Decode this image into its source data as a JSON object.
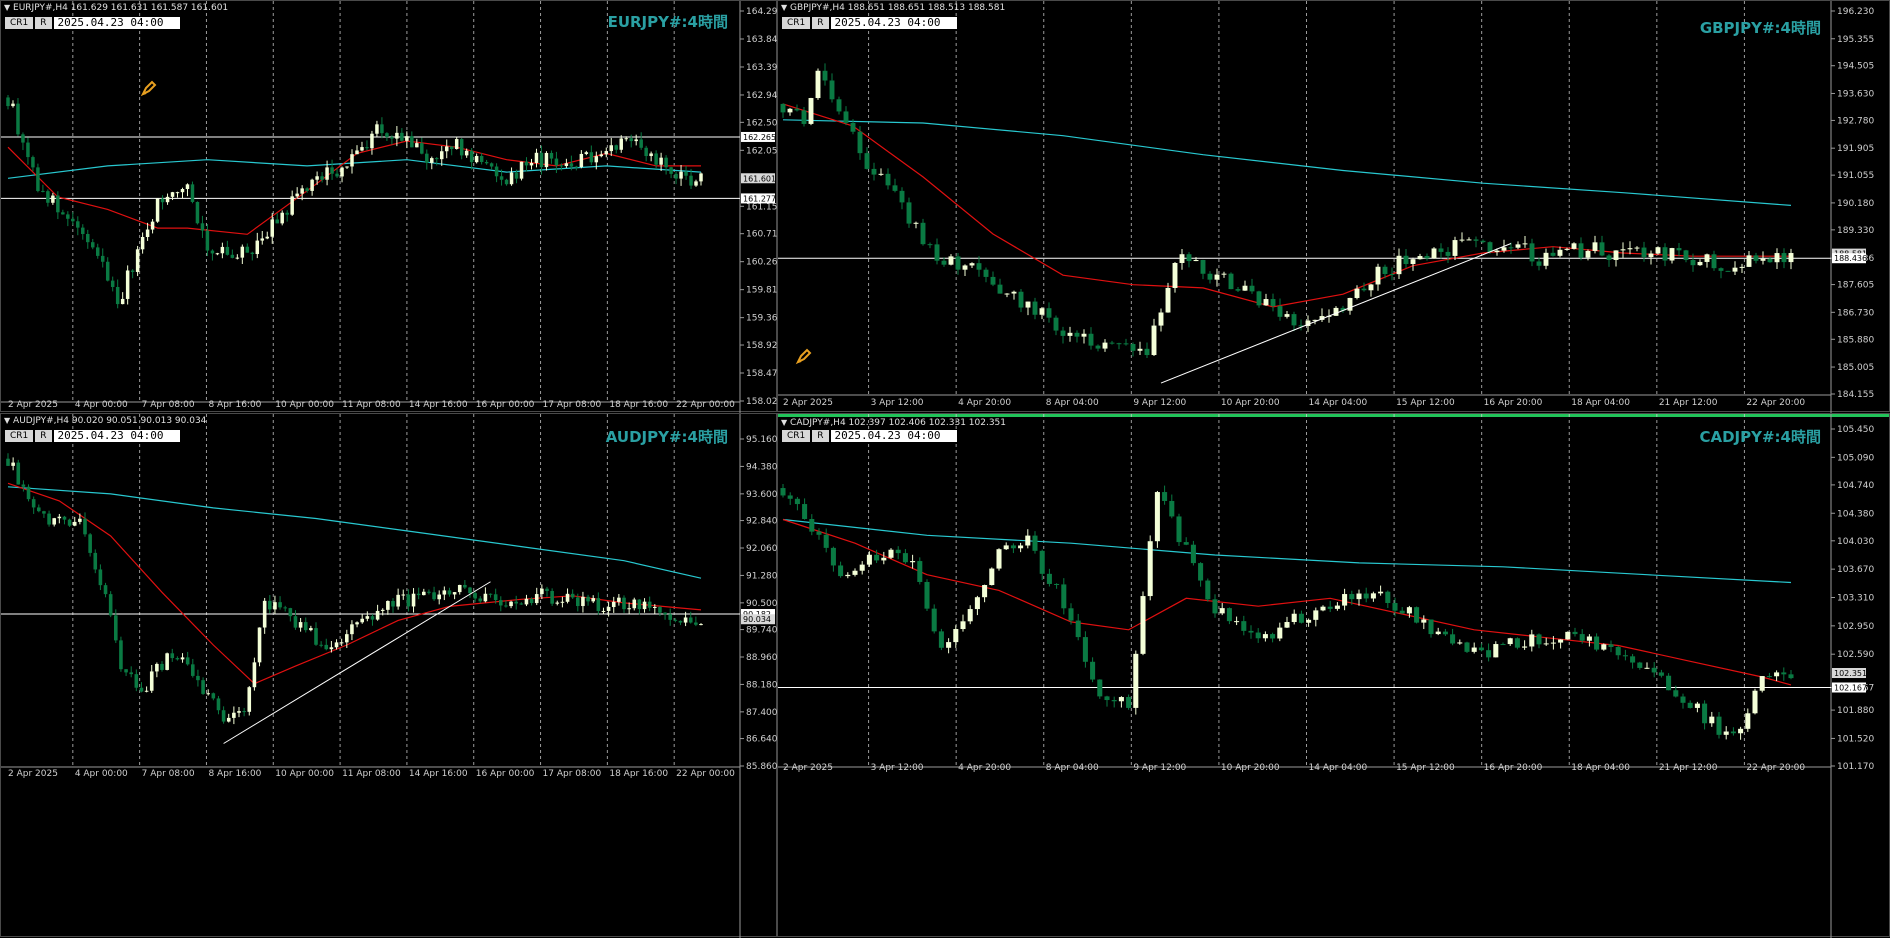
{
  "colors": {
    "background": "#000000",
    "grid": "#ffffff",
    "bull_candle": "#f4ffd8",
    "bear_candle": "#0a7a43",
    "ma_fast": "#e01010",
    "ma_slow": "#28c8d0",
    "title": "#2aa0a3"
  },
  "panes": [
    {
      "header": "EURJPY#,H4  161.629 161.631 161.587 161.601",
      "title": "EURJPY#:4時間",
      "cr_label": "CR1",
      "r_label": "R",
      "timestamp": "2025.04.23 04:00",
      "icon": "pencil-icon"
    },
    {
      "header": "GBPJPY#,H4  188.651 188.651 188.513 188.581",
      "title": "GBPJPY#:4時間",
      "cr_label": "CR1",
      "r_label": "R",
      "timestamp": "2025.04.23 04:00",
      "icon": "pencil-icon"
    },
    {
      "header": "AUDJPY#,H4  90.020 90.051 90.013 90.034",
      "title": "AUDJPY#:4時間",
      "cr_label": "CR1",
      "r_label": "R",
      "timestamp": "2025.04.23 04:00"
    },
    {
      "header": "CADJPY#,H4  102.397 102.406 102.331 102.351",
      "title": "CADJPY#:4時間",
      "cr_label": "CR1",
      "r_label": "R",
      "timestamp": "2025.04.23 04:00"
    }
  ],
  "chart_data": [
    {
      "type": "candlestick",
      "symbol": "EURJPY#",
      "timeframe": "H4",
      "ylim": [
        158.02,
        164.29
      ],
      "yticks": [
        164.29,
        163.84,
        163.39,
        162.94,
        162.5,
        162.05,
        161.15,
        160.71,
        160.26,
        159.81,
        159.36,
        158.92,
        158.47,
        158.02
      ],
      "xticks": [
        "2 Apr 2025",
        "4 Apr 00:00",
        "7 Apr 08:00",
        "8 Apr 16:00",
        "10 Apr 00:00",
        "11 Apr 08:00",
        "14 Apr 16:00",
        "16 Apr 00:00",
        "17 Apr 08:00",
        "18 Apr 16:00",
        "22 Apr 00:00"
      ],
      "hlines": [
        162.265,
        161.277
      ],
      "price_labels": [
        "162.265",
        "161.601",
        "161.277"
      ],
      "current_price": 161.601,
      "close_path": [
        [
          0,
          162.9
        ],
        [
          6,
          161.5
        ],
        [
          12,
          160.9
        ],
        [
          18,
          160.4
        ],
        [
          22,
          159.6
        ],
        [
          26,
          160.4
        ],
        [
          30,
          161.2
        ],
        [
          36,
          161.5
        ],
        [
          40,
          160.5
        ],
        [
          46,
          160.3
        ],
        [
          52,
          160.7
        ],
        [
          58,
          161.3
        ],
        [
          62,
          161.6
        ],
        [
          68,
          161.8
        ],
        [
          74,
          162.4
        ],
        [
          80,
          162.2
        ],
        [
          84,
          161.9
        ],
        [
          90,
          162.1
        ],
        [
          96,
          161.8
        ],
        [
          100,
          161.6
        ],
        [
          106,
          161.9
        ],
        [
          112,
          161.8
        ],
        [
          118,
          162.0
        ],
        [
          124,
          162.3
        ],
        [
          130,
          161.9
        ],
        [
          135,
          161.6
        ],
        [
          139,
          161.6
        ]
      ],
      "ma_fast": [
        [
          0,
          162.1
        ],
        [
          10,
          161.3
        ],
        [
          20,
          161.1
        ],
        [
          30,
          160.8
        ],
        [
          36,
          160.8
        ],
        [
          48,
          160.7
        ],
        [
          60,
          161.4
        ],
        [
          70,
          162.0
        ],
        [
          80,
          162.2
        ],
        [
          90,
          162.1
        ],
        [
          100,
          161.9
        ],
        [
          110,
          161.8
        ],
        [
          120,
          162.0
        ],
        [
          130,
          161.8
        ],
        [
          139,
          161.8
        ]
      ],
      "ma_slow": [
        [
          0,
          161.6
        ],
        [
          20,
          161.8
        ],
        [
          40,
          161.9
        ],
        [
          60,
          161.8
        ],
        [
          80,
          161.9
        ],
        [
          100,
          161.7
        ],
        [
          120,
          161.8
        ],
        [
          139,
          161.7
        ]
      ]
    },
    {
      "type": "candlestick",
      "symbol": "GBPJPY#",
      "timeframe": "H4",
      "ylim": [
        184.155,
        196.23
      ],
      "yticks": [
        196.23,
        195.355,
        194.505,
        193.63,
        192.78,
        191.905,
        191.055,
        190.18,
        189.33,
        188.436,
        187.605,
        186.73,
        185.88,
        185.005,
        184.155
      ],
      "xticks": [
        "2 Apr 2025",
        "3 Apr 12:00",
        "4 Apr 20:00",
        "8 Apr 04:00",
        "9 Apr 12:00",
        "10 Apr 20:00",
        "14 Apr 04:00",
        "15 Apr 12:00",
        "16 Apr 20:00",
        "18 Apr 04:00",
        "21 Apr 12:00",
        "22 Apr 20:00"
      ],
      "hlines": [
        188.436
      ],
      "price_labels": [
        "188.581",
        "188.436"
      ],
      "current_price": 188.581,
      "trendline": [
        [
          54,
          184.5
        ],
        [
          104,
          188.9
        ]
      ],
      "close_path": [
        [
          0,
          193.3
        ],
        [
          3,
          192.9
        ],
        [
          5,
          194.6
        ],
        [
          8,
          193.2
        ],
        [
          12,
          191.5
        ],
        [
          16,
          190.3
        ],
        [
          22,
          188.5
        ],
        [
          28,
          188.0
        ],
        [
          34,
          187.0
        ],
        [
          40,
          186.2
        ],
        [
          52,
          185.3
        ],
        [
          56,
          188.5
        ],
        [
          62,
          187.9
        ],
        [
          68,
          187.2
        ],
        [
          74,
          186.2
        ],
        [
          80,
          186.9
        ],
        [
          86,
          188.1
        ],
        [
          92,
          188.7
        ],
        [
          98,
          188.8
        ],
        [
          104,
          188.9
        ],
        [
          108,
          188.4
        ],
        [
          114,
          188.7
        ],
        [
          120,
          188.6
        ],
        [
          128,
          188.5
        ],
        [
          134,
          188.2
        ],
        [
          140,
          188.5
        ],
        [
          144,
          188.6
        ]
      ],
      "ma_fast": [
        [
          0,
          193.3
        ],
        [
          10,
          192.6
        ],
        [
          20,
          191.0
        ],
        [
          30,
          189.2
        ],
        [
          40,
          187.9
        ],
        [
          50,
          187.6
        ],
        [
          60,
          187.5
        ],
        [
          70,
          186.9
        ],
        [
          80,
          187.3
        ],
        [
          90,
          188.2
        ],
        [
          100,
          188.6
        ],
        [
          110,
          188.8
        ],
        [
          120,
          188.6
        ],
        [
          130,
          188.5
        ],
        [
          144,
          188.5
        ]
      ],
      "ma_slow": [
        [
          0,
          192.8
        ],
        [
          20,
          192.7
        ],
        [
          40,
          192.3
        ],
        [
          60,
          191.7
        ],
        [
          80,
          191.2
        ],
        [
          100,
          190.8
        ],
        [
          120,
          190.5
        ],
        [
          144,
          190.1
        ]
      ]
    },
    {
      "type": "candlestick",
      "symbol": "AUDJPY#",
      "timeframe": "H4",
      "ylim": [
        85.86,
        95.16
      ],
      "yticks": [
        95.16,
        94.38,
        93.6,
        92.84,
        92.06,
        91.28,
        90.5,
        89.74,
        88.96,
        88.18,
        87.4,
        86.64,
        85.86
      ],
      "xticks": [
        "2 Apr 2025",
        "4 Apr 00:00",
        "7 Apr 08:00",
        "8 Apr 16:00",
        "10 Apr 00:00",
        "11 Apr 08:00",
        "14 Apr 16:00",
        "16 Apr 00:00",
        "17 Apr 08:00",
        "18 Apr 16:00",
        "22 Apr 00:00"
      ],
      "hlines": [
        90.182
      ],
      "price_labels": [
        "90.182",
        "90.034"
      ],
      "current_price": 90.034,
      "trendline": [
        [
          42,
          86.5
        ],
        [
          94,
          91.1
        ]
      ],
      "close_path": [
        [
          0,
          94.6
        ],
        [
          4,
          93.4
        ],
        [
          8,
          92.8
        ],
        [
          14,
          92.7
        ],
        [
          18,
          91.2
        ],
        [
          22,
          88.8
        ],
        [
          26,
          88.0
        ],
        [
          30,
          88.8
        ],
        [
          34,
          89.1
        ],
        [
          38,
          88.0
        ],
        [
          42,
          87.2
        ],
        [
          46,
          87.4
        ],
        [
          50,
          90.5
        ],
        [
          56,
          90.0
        ],
        [
          62,
          89.2
        ],
        [
          68,
          89.9
        ],
        [
          74,
          90.5
        ],
        [
          80,
          90.6
        ],
        [
          86,
          90.9
        ],
        [
          92,
          90.6
        ],
        [
          98,
          90.5
        ],
        [
          104,
          90.7
        ],
        [
          110,
          90.6
        ],
        [
          116,
          90.4
        ],
        [
          122,
          90.5
        ],
        [
          128,
          90.2
        ],
        [
          132,
          90.1
        ],
        [
          135,
          90.0
        ]
      ],
      "ma_fast": [
        [
          0,
          93.9
        ],
        [
          10,
          93.4
        ],
        [
          20,
          92.4
        ],
        [
          30,
          90.8
        ],
        [
          40,
          89.3
        ],
        [
          48,
          88.2
        ],
        [
          56,
          88.7
        ],
        [
          66,
          89.3
        ],
        [
          76,
          90.0
        ],
        [
          86,
          90.4
        ],
        [
          100,
          90.6
        ],
        [
          110,
          90.7
        ],
        [
          120,
          90.5
        ],
        [
          135,
          90.3
        ]
      ],
      "ma_slow": [
        [
          0,
          93.8
        ],
        [
          20,
          93.6
        ],
        [
          40,
          93.2
        ],
        [
          60,
          92.9
        ],
        [
          80,
          92.5
        ],
        [
          100,
          92.1
        ],
        [
          120,
          91.7
        ],
        [
          135,
          91.2
        ]
      ]
    },
    {
      "type": "candlestick",
      "symbol": "CADJPY#",
      "timeframe": "H4",
      "ylim": [
        101.17,
        105.45
      ],
      "yticks": [
        105.45,
        105.09,
        104.74,
        104.38,
        104.03,
        103.67,
        103.31,
        102.95,
        102.59,
        102.167,
        101.88,
        101.52,
        101.17
      ],
      "xticks": [
        "2 Apr 2025",
        "3 Apr 12:00",
        "4 Apr 20:00",
        "8 Apr 04:00",
        "9 Apr 12:00",
        "10 Apr 20:00",
        "14 Apr 04:00",
        "15 Apr 12:00",
        "16 Apr 20:00",
        "18 Apr 04:00",
        "21 Apr 12:00",
        "22 Apr 20:00"
      ],
      "hlines": [
        102.167
      ],
      "price_labels": [
        "102.351",
        "102.167"
      ],
      "current_price": 102.351,
      "close_path": [
        [
          0,
          104.7
        ],
        [
          4,
          104.2
        ],
        [
          8,
          103.6
        ],
        [
          14,
          103.9
        ],
        [
          18,
          103.7
        ],
        [
          22,
          102.6
        ],
        [
          26,
          103.2
        ],
        [
          30,
          103.9
        ],
        [
          34,
          104.0
        ],
        [
          38,
          103.4
        ],
        [
          44,
          102.1
        ],
        [
          48,
          101.9
        ],
        [
          52,
          104.7
        ],
        [
          56,
          103.9
        ],
        [
          60,
          103.2
        ],
        [
          66,
          102.7
        ],
        [
          70,
          103.0
        ],
        [
          76,
          103.2
        ],
        [
          80,
          103.4
        ],
        [
          86,
          103.2
        ],
        [
          92,
          102.8
        ],
        [
          98,
          102.6
        ],
        [
          104,
          102.8
        ],
        [
          110,
          102.8
        ],
        [
          116,
          102.6
        ],
        [
          122,
          102.3
        ],
        [
          128,
          101.8
        ],
        [
          132,
          101.5
        ],
        [
          136,
          102.35
        ],
        [
          140,
          102.35
        ]
      ],
      "ma_fast": [
        [
          0,
          104.3
        ],
        [
          10,
          104.0
        ],
        [
          20,
          103.6
        ],
        [
          30,
          103.4
        ],
        [
          40,
          103.0
        ],
        [
          48,
          102.9
        ],
        [
          56,
          103.3
        ],
        [
          66,
          103.2
        ],
        [
          76,
          103.3
        ],
        [
          86,
          103.1
        ],
        [
          96,
          102.9
        ],
        [
          106,
          102.8
        ],
        [
          116,
          102.7
        ],
        [
          126,
          102.5
        ],
        [
          136,
          102.3
        ],
        [
          140,
          102.2
        ]
      ],
      "ma_slow": [
        [
          0,
          104.3
        ],
        [
          20,
          104.1
        ],
        [
          40,
          104.0
        ],
        [
          60,
          103.85
        ],
        [
          80,
          103.75
        ],
        [
          100,
          103.7
        ],
        [
          120,
          103.6
        ],
        [
          140,
          103.5
        ]
      ]
    }
  ]
}
